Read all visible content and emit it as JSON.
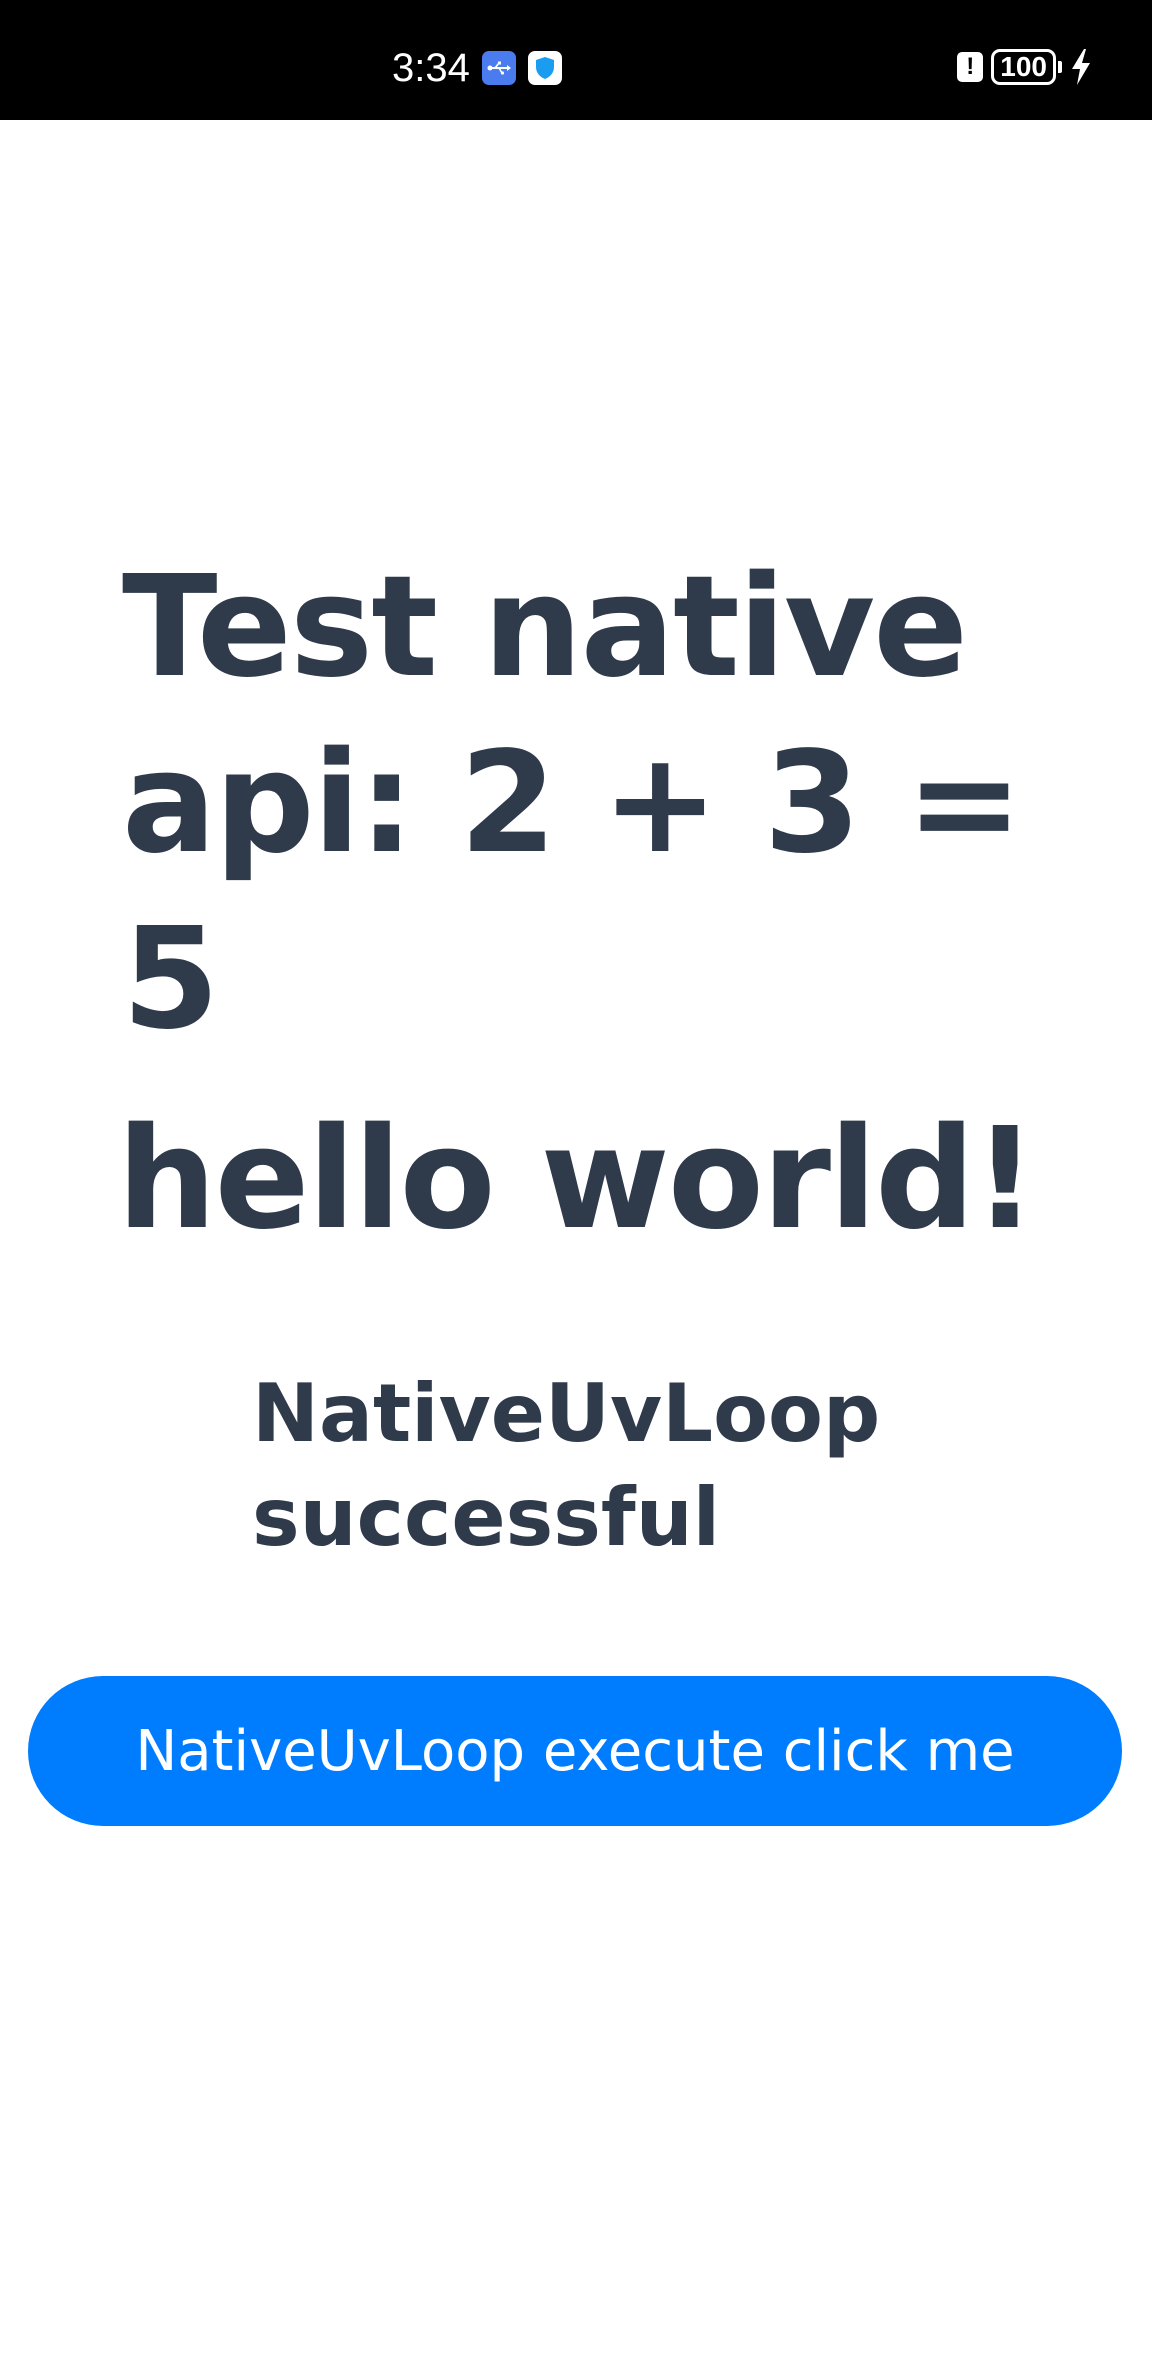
{
  "status_bar": {
    "time": "3:34",
    "battery_level": "100",
    "icons": [
      "usb-icon",
      "shield-icon",
      "alert-icon",
      "battery-icon",
      "charging-bolt-icon"
    ]
  },
  "main": {
    "title": "Test native api: 2 + 3 = 5",
    "greeting": "hello world!",
    "status_message": "NativeUvLoop successful",
    "button_label": "NativeUvLoop execute click me"
  },
  "colors": {
    "text": "#2f3a4b",
    "button_bg": "#007dff",
    "button_text": "#ffffff",
    "status_bar_bg": "#000000"
  }
}
